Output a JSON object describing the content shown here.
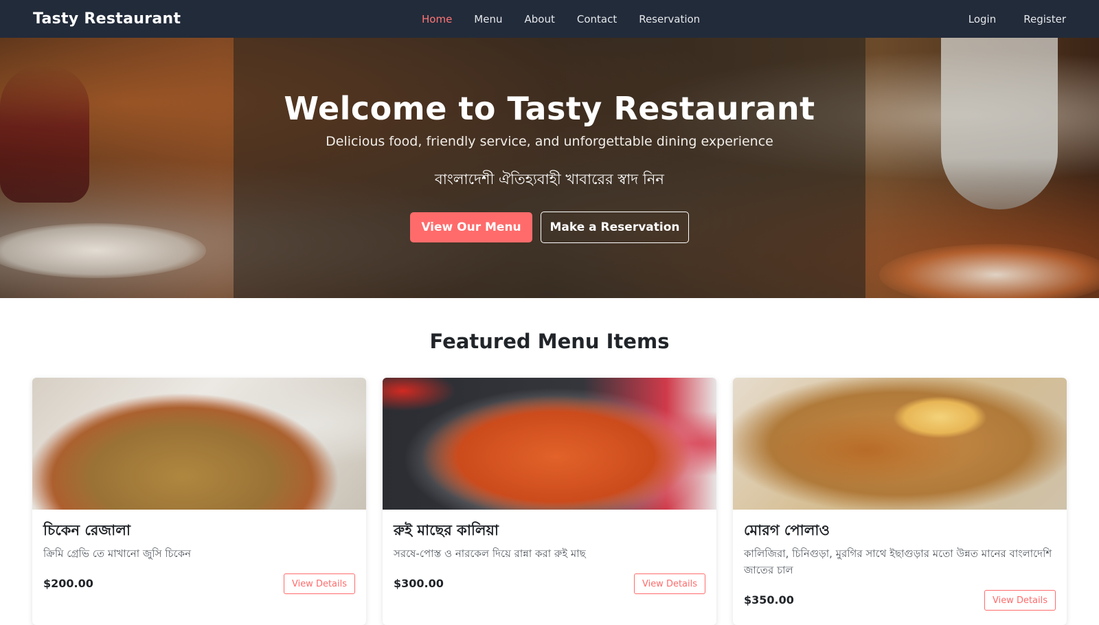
{
  "navbar": {
    "brand": "Tasty Restaurant",
    "links": [
      "Home",
      "Menu",
      "About",
      "Contact",
      "Reservation"
    ],
    "auth": [
      "Login",
      "Register"
    ],
    "active": "Home"
  },
  "hero": {
    "title": "Welcome to Tasty Restaurant",
    "subtitle": "Delicious food, friendly service, and unforgettable dining experience",
    "subtitle_bn": "বাংলাদেশী ঐতিহ্যবাহী খাবারের স্বাদ নিন",
    "primary_button": "View Our Menu",
    "secondary_button": "Make a Reservation"
  },
  "featured": {
    "title": "Featured Menu Items",
    "items": [
      {
        "name": "চিকেন রেজালা",
        "description": "ক্রিমি গ্রেভি তে মাখানো জুসি চিকেন",
        "price": "$200.00",
        "button": "View Details"
      },
      {
        "name": "রুই মাছের কালিয়া",
        "description": "সরষে-পোস্ত ও নারকেল দিয়ে রান্না করা রুই মাছ",
        "price": "$300.00",
        "button": "View Details"
      },
      {
        "name": "মোরগ পোলাও",
        "description": "কালিজিরা, চিনিগুড়া, মুরগির সাথে ইছাগুড়ার মতো উন্নত মানের বাংলাদেশি জাতের চাল",
        "price": "$350.00",
        "button": "View Details"
      }
    ]
  },
  "colors": {
    "navbar": "#222b3a",
    "accent": "#ff6b6b",
    "active_link": "#ff7575"
  }
}
